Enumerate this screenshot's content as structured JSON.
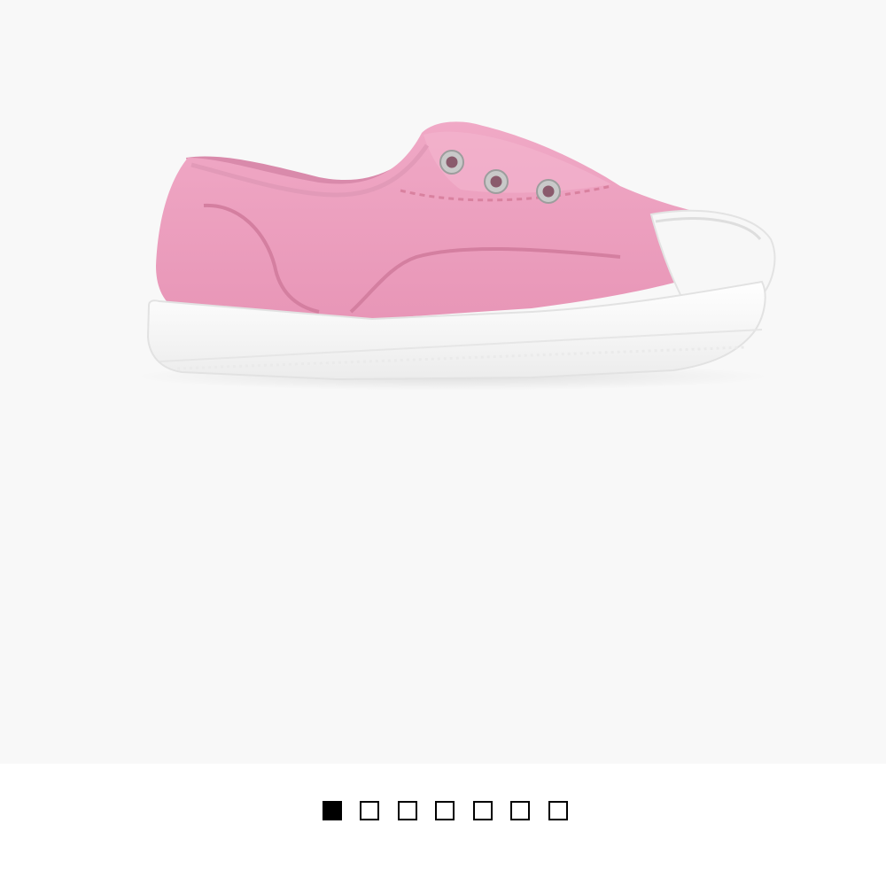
{
  "product_image": {
    "icon": "pink-slip-on-sneaker-image",
    "colors": {
      "background": "#f8f8f8",
      "canvas": "#ed9fbe",
      "sole": "#ffffff"
    }
  },
  "pager": {
    "count": 7,
    "active_index": 0,
    "colors": {
      "active": "#000000",
      "inactive_fill": "#ffffff",
      "border": "#000000"
    }
  }
}
